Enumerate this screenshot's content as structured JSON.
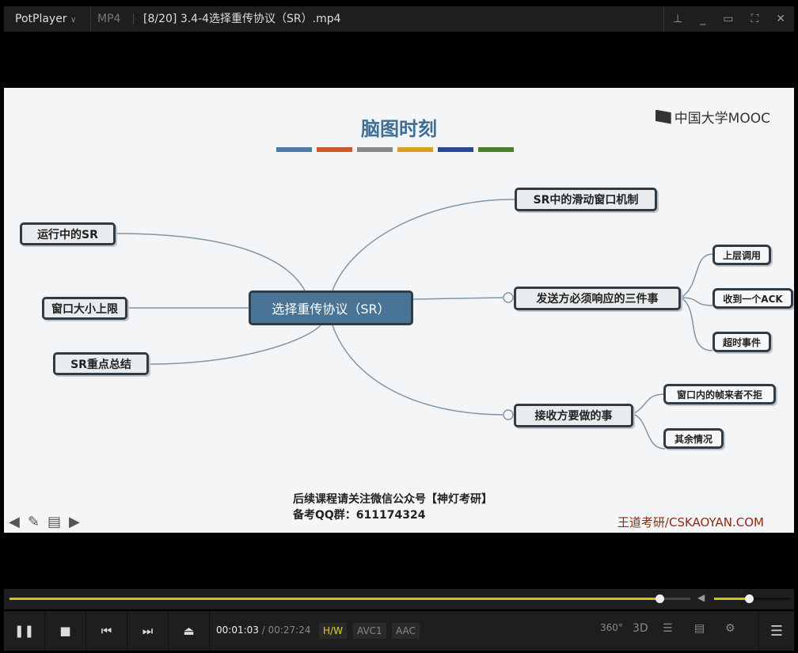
{
  "titlebar": {
    "app": "PotPlayer",
    "format": "MP4",
    "title": "[8/20] 3.4-4选择重传协议（SR）.mp4"
  },
  "video": {
    "title": "脑图时刻",
    "title_bar_colors": [
      "#4a7aa8",
      "#c85a2a",
      "#888888",
      "#d4a020",
      "#2a4a90",
      "#4a8030"
    ],
    "logo": "中国大学MOOC",
    "center": "选择重传协议（SR）",
    "left_nodes": [
      "运行中的SR",
      "窗口大小上限",
      "SR重点总结"
    ],
    "right_nodes": [
      "SR中的滑动窗口机制",
      "发送方必须响应的三件事",
      "接收方要做的事"
    ],
    "sender_children": [
      "上层调用",
      "收到一个ACK",
      "超时事件"
    ],
    "receiver_children": [
      "窗口内的帧来者不拒",
      "其余情况"
    ],
    "footer_line1": "后续课程请关注微信公众号【神灯考研】",
    "footer_line2": "备考QQ群：611174324",
    "watermark": "王道考研/CSKAOYAN.COM"
  },
  "player": {
    "progress": 0.955,
    "volume": 0.45,
    "current_time": "00:01:03",
    "separator": "/",
    "total_time": "00:27:24",
    "tags": [
      "H/W",
      "AVC1",
      "AAC"
    ],
    "accent": "#d4c21a"
  }
}
